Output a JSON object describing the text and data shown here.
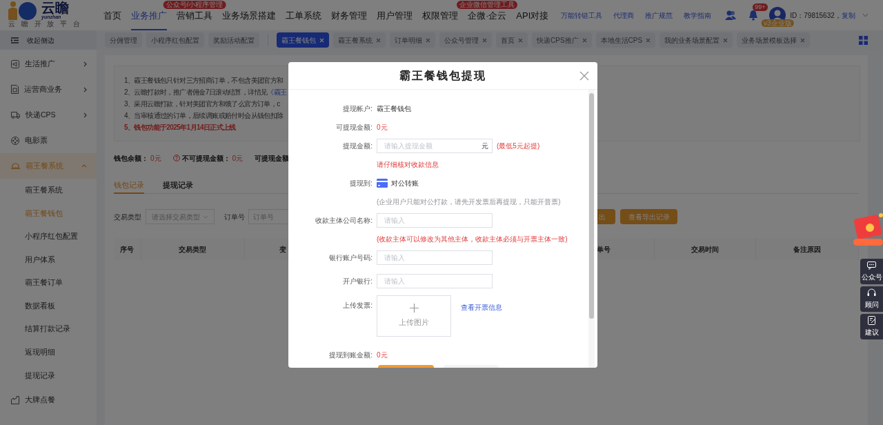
{
  "header": {
    "logo": {
      "wordmark": "云瞻",
      "latin": "yunzhan",
      "tagline": "云 瞻 开 放 平 台"
    },
    "nav": [
      {
        "label": "首页",
        "selected": false
      },
      {
        "label": "业务推广",
        "selected": true
      },
      {
        "label": "营销工具",
        "selected": false,
        "badge": "公众号/小程序管理"
      },
      {
        "label": "业务场景搭建",
        "selected": false
      },
      {
        "label": "工单系统",
        "selected": false
      },
      {
        "label": "财务管理",
        "selected": false
      },
      {
        "label": "用户管理",
        "selected": false
      },
      {
        "label": "权限管理",
        "selected": false
      },
      {
        "label": "企微·企云",
        "selected": false,
        "badge": "企业微信管理工具"
      },
      {
        "label": "API对接",
        "selected": false
      }
    ],
    "links": [
      "万能转链工具",
      "代理商",
      "推广规范",
      "教学指南"
    ],
    "notification_count": "99+",
    "plan": "v3企业版",
    "account_id": "ID：79815632，",
    "copy": "复制"
  },
  "sidebar": {
    "collapse": "收起侧边",
    "items": [
      {
        "label": "生活推广",
        "expanded": false
      },
      {
        "label": "运营商业务",
        "expanded": false
      },
      {
        "label": "快递CPS",
        "expanded": false
      },
      {
        "label": "电影票"
      },
      {
        "label": "霸王餐系统",
        "expanded": true,
        "children": [
          {
            "label": "霸王餐系统",
            "selected": false
          },
          {
            "label": "霸王餐钱包",
            "selected": true
          },
          {
            "label": "小程序红包配置",
            "selected": false
          },
          {
            "label": "用户体系",
            "selected": false
          },
          {
            "label": "霸王餐订单",
            "selected": false
          },
          {
            "label": "数据看板",
            "selected": false
          },
          {
            "label": "结算打款记录",
            "selected": false
          },
          {
            "label": "返现明细",
            "selected": false
          },
          {
            "label": "提现记录",
            "selected": false
          }
        ]
      },
      {
        "label": "大牌点餐"
      }
    ]
  },
  "tabs": [
    {
      "label": "分佣管理",
      "selected": false,
      "closable": false
    },
    {
      "label": "小程序红包配置",
      "selected": false,
      "closable": false
    },
    {
      "label": "奖励活动配置",
      "selected": false,
      "closable": false
    },
    {
      "label": "霸王餐钱包",
      "selected": true,
      "closable": true
    },
    {
      "label": "霸王餐系统",
      "selected": false,
      "closable": true
    },
    {
      "label": "订单明细",
      "selected": false,
      "closable": true
    },
    {
      "label": "公众号管理",
      "selected": false,
      "closable": true
    },
    {
      "label": "首页",
      "selected": false,
      "closable": true
    },
    {
      "label": "快递CPS推广",
      "selected": false,
      "closable": true
    },
    {
      "label": "本地生活CPS",
      "selected": false,
      "closable": true
    },
    {
      "label": "我的业务场景配置",
      "selected": false,
      "closable": true
    },
    {
      "label": "业务场景模板选择",
      "selected": false,
      "closable": true
    }
  ],
  "notice": [
    {
      "text": "1、霸王餐钱包只针对三方招商订单，不包含美团官方和",
      "highlight": false
    },
    {
      "text": "2、云瞻打款时，推广者佣金7日滚动结算，详情见",
      "link": "《霸王",
      "highlight": false
    },
    {
      "text": "3、采用云瞻打款，针对美团官方和饿了么官方订单，c",
      "highlight": false
    },
    {
      "text": "4、当审核通过的订单，后续调账或赔付时会从钱包扣除",
      "highlight": false
    },
    {
      "text": "5、钱包功能于2025年1月14日正式上线",
      "highlight": true
    }
  ],
  "balances": [
    {
      "label": "钱包余额：",
      "value": "0元",
      "help": false
    },
    {
      "label": "不可提现金额：",
      "value": "0元",
      "help": true
    },
    {
      "label": "可提现金额",
      "help": false
    }
  ],
  "record_tabs": [
    {
      "label": "钱包记录",
      "selected": true
    },
    {
      "label": "提现记录",
      "selected": false
    }
  ],
  "filters": {
    "type_label": "交易类型",
    "type_placeholder": "请选择交易类型",
    "order_label": "订单号",
    "order_placeholder": "订单号",
    "buttons": [
      "出",
      "查看导出记录"
    ]
  },
  "table": {
    "columns_left": [
      "序号",
      "交易类型",
      "变"
    ],
    "columns_right": [
      "单号",
      "交易时间",
      "备注原因"
    ]
  },
  "modal": {
    "title": "霸王餐钱包提现",
    "rows": [
      {
        "kind": "value",
        "label": "提现帐户:",
        "value": "霸王餐钱包",
        "highlight": false
      },
      {
        "kind": "value",
        "label": "可提现金额:",
        "value": "0元",
        "highlight": true
      },
      {
        "kind": "amount",
        "label": "提现金额:",
        "placeholder": "请输入提现金额",
        "unit": "元",
        "hint": "(最低5元起提)"
      },
      {
        "kind": "note",
        "text": "请仔细核对收款信息",
        "highlight": true
      },
      {
        "kind": "method",
        "label": "提现到:",
        "value": "对公转账"
      },
      {
        "kind": "note",
        "text": "(企业用户只能对公打款，请先开发票后再提现，只能开普票)",
        "highlight": false
      },
      {
        "kind": "input",
        "label": "收款主体公司名称:",
        "placeholder": "请输入"
      },
      {
        "kind": "note",
        "text": "(收款主体可以修改为其他主体，收款主体必须与开票主体一致)",
        "highlight": true
      },
      {
        "kind": "input",
        "label": "银行账户号码:",
        "placeholder": "请输入"
      },
      {
        "kind": "input",
        "label": "开户银行:",
        "placeholder": "请输入"
      },
      {
        "kind": "upload",
        "label": "上传发票:",
        "button": "上传图片",
        "link": "查看开票信息"
      },
      {
        "kind": "value",
        "label": "提现到账金额:",
        "value": "0元",
        "highlight": true
      }
    ]
  },
  "side_tools": [
    "公众号",
    "顾问",
    "建议"
  ]
}
